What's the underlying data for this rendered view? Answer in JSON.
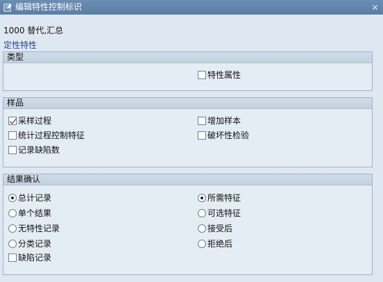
{
  "window": {
    "title": "编辑特性控制标识"
  },
  "header": {
    "text": "1000 替代,汇总",
    "link": "定性特性"
  },
  "group_type": {
    "title": "类型",
    "items": [
      {
        "label": "特性属性",
        "checked": false
      }
    ]
  },
  "group_sample": {
    "title": "样品",
    "items": [
      {
        "label": "采样过程",
        "checked": true
      },
      {
        "label": "增加样本",
        "checked": false
      },
      {
        "label": "统计过程控制特征",
        "checked": false
      },
      {
        "label": "破坏性检验",
        "checked": false
      },
      {
        "label": "记录缺陷数",
        "checked": false
      }
    ]
  },
  "group_result": {
    "title": "结果确认",
    "left_radios": [
      {
        "label": "总计记录",
        "selected": true
      },
      {
        "label": "单个结果",
        "selected": false
      },
      {
        "label": "无特性记录",
        "selected": false
      },
      {
        "label": "分类记录",
        "selected": false
      }
    ],
    "right_radios": [
      {
        "label": "所需特征",
        "selected": true
      },
      {
        "label": "可选特征",
        "selected": false
      },
      {
        "label": "接受后",
        "selected": false
      },
      {
        "label": "拒绝后",
        "selected": false
      }
    ],
    "checkbox": {
      "label": "缺陷记录",
      "checked": false
    }
  }
}
